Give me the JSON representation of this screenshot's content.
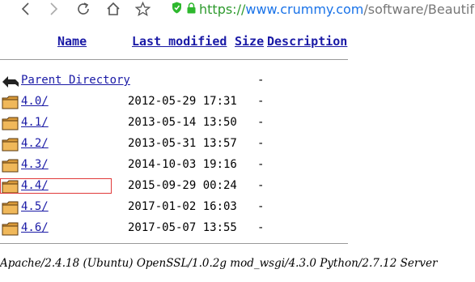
{
  "browser": {
    "url_prefix": "https://",
    "url_host": "www.crummy.com",
    "url_path": "/software/BeautifulS",
    "icons": [
      "back-icon",
      "forward-icon",
      "reload-icon",
      "home-icon",
      "star-icon",
      "secure-shield-icon",
      "lock-icon"
    ]
  },
  "listing": {
    "headers": {
      "name": "Name",
      "last_modified": "Last modified",
      "size": "Size",
      "description": "Description"
    },
    "parent": {
      "label": "Parent Directory",
      "size": "-"
    },
    "rows": [
      {
        "name": "4.0/",
        "modified": "2012-05-29 17:31",
        "size": "-"
      },
      {
        "name": "4.1/",
        "modified": "2013-05-14 13:50",
        "size": "-"
      },
      {
        "name": "4.2/",
        "modified": "2013-05-31 13:57",
        "size": "-"
      },
      {
        "name": "4.3/",
        "modified": "2014-10-03 19:16",
        "size": "-"
      },
      {
        "name": "4.4/",
        "modified": "2015-09-29 00:24",
        "size": "-"
      },
      {
        "name": "4.5/",
        "modified": "2017-01-02 16:03",
        "size": "-"
      },
      {
        "name": "4.6/",
        "modified": "2017-05-07 13:55",
        "size": "-"
      }
    ],
    "highlight_color": "#e03a3a"
  },
  "footer": {
    "server_signature": "Apache/2.4.18 (Ubuntu) OpenSSL/1.0.2g mod_wsgi/4.3.0 Python/2.7.12 Server"
  }
}
